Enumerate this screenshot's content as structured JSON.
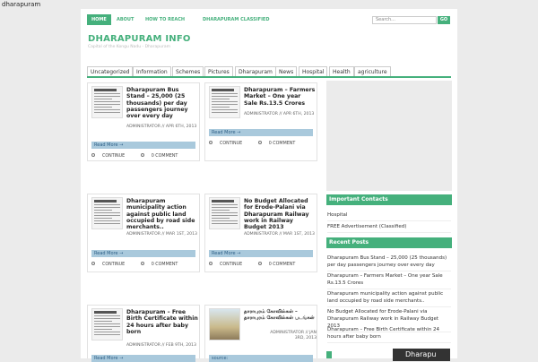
{
  "site_label": "dharapuram",
  "topnav": [
    {
      "label": "HOME",
      "active": true
    },
    {
      "label": "ABOUT",
      "active": false
    },
    {
      "label": "HOW TO REACH",
      "active": false
    },
    {
      "label": "DHARAPURAM CLASSIFIED",
      "active": false
    }
  ],
  "search": {
    "placeholder": "Search...",
    "button": "GO"
  },
  "site_title": "DHARAPURAM INFO",
  "tagline": "Capital of the Kongu Nadu - Dharapuram",
  "categories": [
    "Uncategorized",
    "Information",
    "Schemes",
    "Pictures",
    "Dharapuram",
    "News",
    "Hospital",
    "Health",
    "agriculture"
  ],
  "posts": [
    {
      "title": "Dharapuram Bus Stand – 25,000 (25 thousands) per day passengers journey over every day",
      "meta": "ADMINISTRATOR // APR 6TH, 2013",
      "read_more": "Read More →",
      "continue": "CONTINUE",
      "comments": "0 COMMENT"
    },
    {
      "title": "Dharapuram – Farmers Market – One year Sale Rs.13.5 Crores",
      "meta": "ADMINISTRATOR // APR 6TH, 2013",
      "read_more": "Read More →",
      "continue": "CONTINUE",
      "comments": "0 COMMENT"
    },
    {
      "title": "Dharapuram municipality action against public land occupied by road side merchants..",
      "meta": "ADMINISTRATOR // MAR 1ST, 2013",
      "read_more": "Read More →",
      "continue": "CONTINUE",
      "comments": "0 COMMENT"
    },
    {
      "title": "No Budget Allocated for Erode-Palani via Dharapuram Railway work in Railway Budget 2013",
      "meta": "ADMINISTRATOR // MAR 1ST, 2013",
      "read_more": "Read More →",
      "continue": "CONTINUE",
      "comments": "0 COMMENT"
    },
    {
      "title": "Dharapuram – Free Birth Certificate within 24 hours after baby born",
      "meta": "ADMINISTRATOR // FEB 9TH, 2013",
      "read_more": "Read More →"
    },
    {
      "title": "தாராபுரம் கோவில்கள் – தாராபுரம் கோவில்கள் படங்கள்",
      "meta": "ADMINISTRATOR // JAN 3RD, 2013",
      "read_more": "source:"
    }
  ],
  "widgets": {
    "contacts": {
      "heading": "Important Contacts",
      "items": [
        "Hospital",
        "FREE Advertisement (Classified)"
      ]
    },
    "recent": {
      "heading": "Recent Posts",
      "items": [
        "Dharapuram Bus Stand – 25,000 (25 thousands) per day passengers journey over every day",
        "Dharapuram – Farmers Market – One year Sale Rs.13.5 Crores",
        "Dharapuram municipality action against public land occupied by road side merchants..",
        "No Budget Allocated for Erode-Palani via Dharapuram Railway work in Railway Budget 2013",
        "Dharapuram – Free Birth Certificate within 24 hours after baby born"
      ]
    },
    "thumb_label": "Dharapu"
  }
}
